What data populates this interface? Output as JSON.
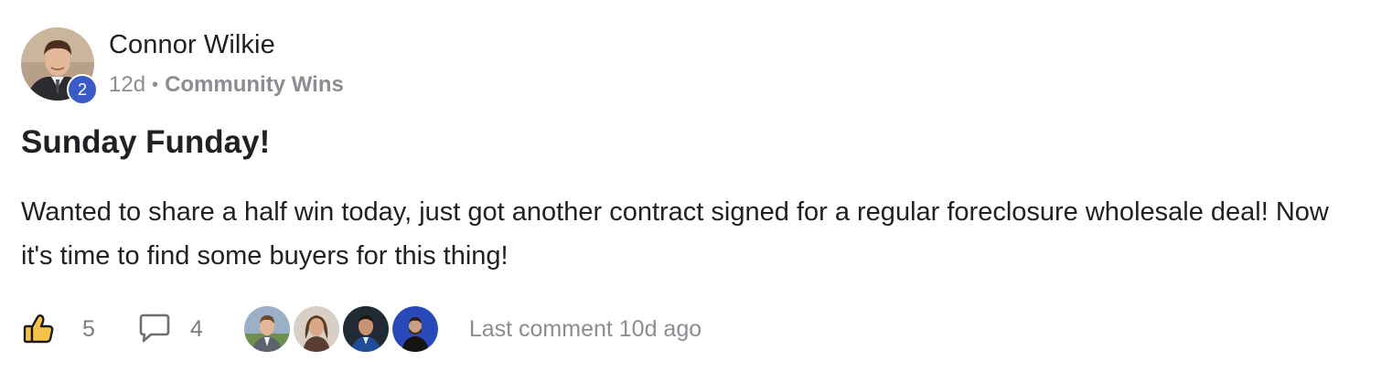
{
  "post": {
    "author": "Connor Wilkie",
    "level": "2",
    "time_ago": "12d",
    "separator": "•",
    "category": "Community Wins",
    "title": "Sunday Funday!",
    "body": "Wanted to share a half win today, just got another contract signed for a regular foreclosure wholesale deal! Now it's time to find some buyers for this thing!"
  },
  "actions": {
    "like_icon": "thumbs-up-icon",
    "like_count": "5",
    "comment_icon": "comment-bubble-icon",
    "comment_count": "4",
    "last_comment": "Last comment 10d ago"
  },
  "colors": {
    "level_badge": "#3b5bc6",
    "like_icon_fill": "#f5c24a",
    "muted_text": "#8a8d91"
  }
}
